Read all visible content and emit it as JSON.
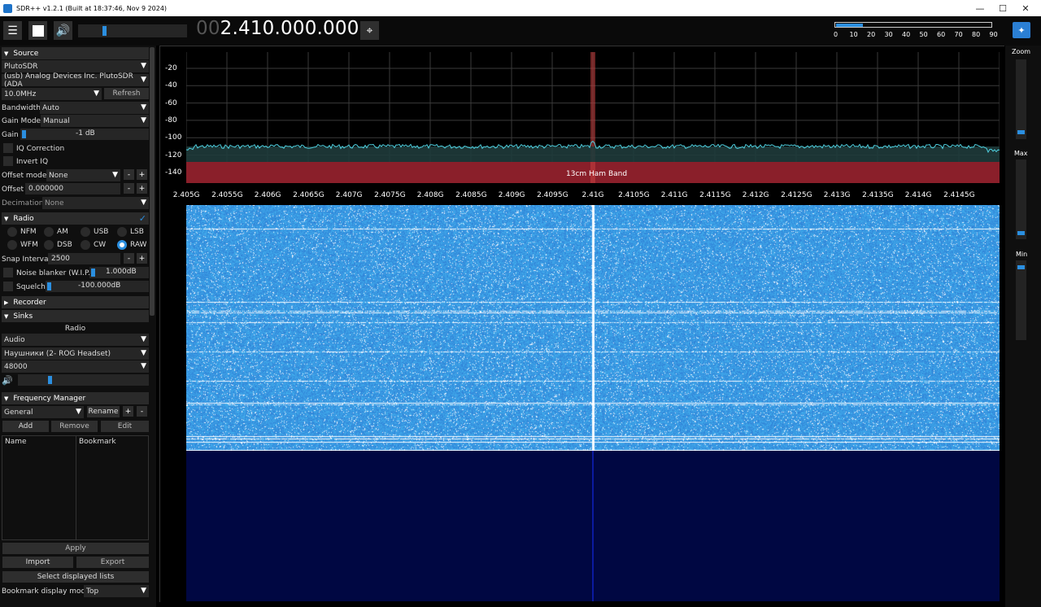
{
  "window": {
    "title": "SDR++ v1.2.1 (Built at 18:37:46, Nov  9 2024)",
    "minimize": "—",
    "maximize": "☐",
    "close": "✕"
  },
  "toolbar": {
    "freq_dim": "00",
    "freq_bright": "2.410.000.000",
    "snr_ticks": [
      "0",
      "10",
      "20",
      "30",
      "40",
      "50",
      "60",
      "70",
      "80",
      "90"
    ],
    "snr_fill_fraction": 0.17,
    "volume_fraction": 0.25
  },
  "source": {
    "header": "Source",
    "device": "PlutoSDR",
    "usb": "(usb) Analog Devices Inc. PlutoSDR (ADA",
    "samplerate": "10.0MHz",
    "refresh": "Refresh",
    "bandwidth_label": "Bandwidth",
    "bandwidth_value": "Auto",
    "gainmode_label": "Gain Mode",
    "gainmode_value": "Manual",
    "gain_label": "Gain",
    "gain_value": "-1 dB",
    "iq_correction": "IQ Correction",
    "invert_iq": "Invert IQ",
    "offset_mode_label": "Offset mode",
    "offset_mode_value": "None",
    "offset_label": "Offset",
    "offset_value": "0.000000",
    "decimation_label": "Decimation",
    "decimation_value": "None"
  },
  "radio": {
    "header": "Radio",
    "modes": [
      "NFM",
      "AM",
      "USB",
      "LSB",
      "WFM",
      "DSB",
      "CW",
      "RAW"
    ],
    "selected": "RAW",
    "snap_label": "Snap Interval",
    "snap_value": "2500",
    "noise_blanker": "Noise blanker (W.I.P.)",
    "noise_value": "1.000dB",
    "squelch": "Squelch",
    "squelch_value": "-100.000dB"
  },
  "recorder": {
    "header": "Recorder"
  },
  "sinks": {
    "header": "Sinks",
    "radio": "Radio",
    "type": "Audio",
    "device": "Наушники (2- ROG Headset)",
    "rate": "48000"
  },
  "freqmgr": {
    "header": "Frequency Manager",
    "list": "General",
    "rename": "Rename",
    "add": "Add",
    "remove": "Remove",
    "edit": "Edit",
    "col_name": "Name",
    "col_bookmark": "Bookmark",
    "apply": "Apply",
    "import": "Import",
    "export": "Export",
    "select_lists": "Select displayed lists",
    "display_mode_label": "Bookmark display mode",
    "display_mode_value": "Top"
  },
  "plot": {
    "y_ticks": [
      "-20",
      "-40",
      "-60",
      "-80",
      "-100",
      "-120",
      "-140"
    ],
    "x_ticks": [
      "2.405G",
      "2.4055G",
      "2.406G",
      "2.4065G",
      "2.407G",
      "2.4075G",
      "2.408G",
      "2.4085G",
      "2.409G",
      "2.4095G",
      "2.41G",
      "2.4105G",
      "2.411G",
      "2.4115G",
      "2.412G",
      "2.4125G",
      "2.413G",
      "2.4135G",
      "2.414G",
      "2.4145G"
    ],
    "band_label": "13cm Ham Band"
  },
  "right": {
    "zoom": "Zoom",
    "max": "Max",
    "min": "Min"
  }
}
